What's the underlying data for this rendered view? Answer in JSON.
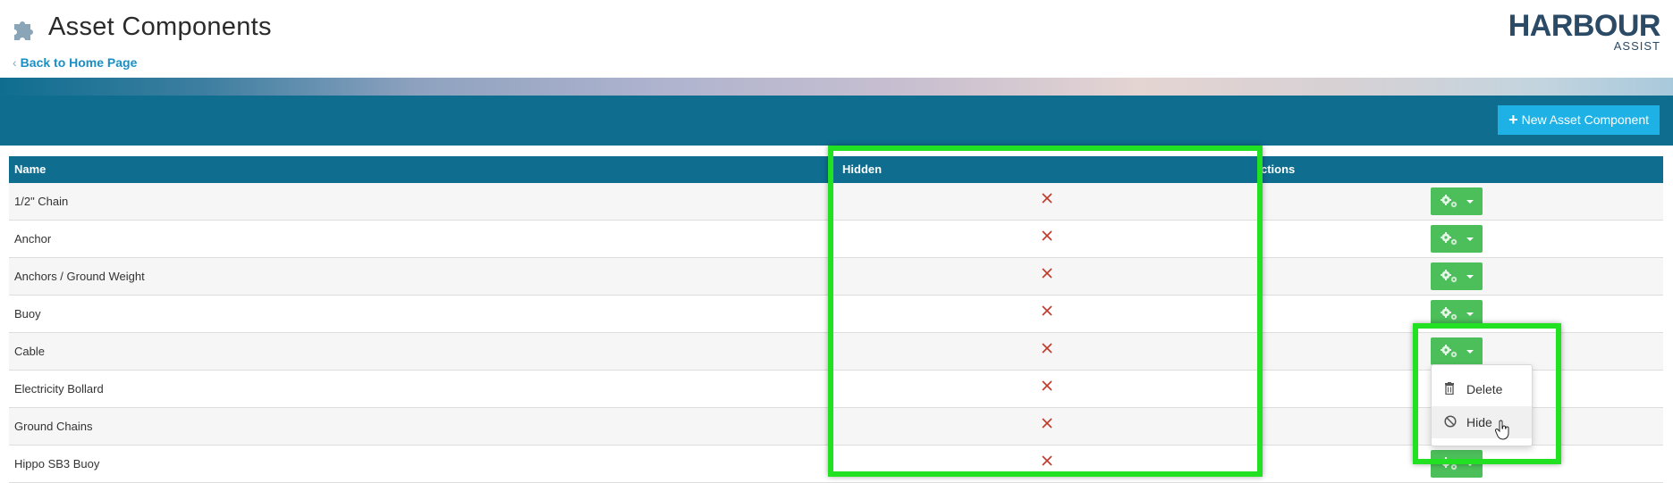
{
  "header": {
    "title": "Asset Components",
    "back_link": "Back to Home Page",
    "logo_main": "HARBOUR",
    "logo_sub": "ASSIST"
  },
  "toolbar": {
    "new_button_label": "New Asset Component"
  },
  "table": {
    "columns": [
      "Name",
      "Hidden",
      "ctions"
    ],
    "rows": [
      {
        "name": "1/2\" Chain",
        "hidden": "×"
      },
      {
        "name": "Anchor",
        "hidden": "×"
      },
      {
        "name": "Anchors / Ground Weight",
        "hidden": "×"
      },
      {
        "name": "Buoy",
        "hidden": "×"
      },
      {
        "name": "Cable",
        "hidden": "×"
      },
      {
        "name": "Electricity Bollard",
        "hidden": "×"
      },
      {
        "name": "Ground Chains",
        "hidden": "×"
      },
      {
        "name": "Hippo SB3 Buoy",
        "hidden": "×"
      }
    ]
  },
  "dropdown": {
    "items": [
      "Delete",
      "Hide"
    ]
  },
  "icons": {
    "header": "puzzle-icon",
    "back": "chevron-left-icon",
    "new": "plus-icon",
    "hidden_value": "x-mark-icon",
    "action": "gears-icon",
    "delete": "trash-icon",
    "hide": "ban-icon"
  },
  "colors": {
    "brand_blue": "#0f6e90",
    "new_button": "#1db1e6",
    "action_button": "#4cbf5a",
    "x_mark": "#c0392b",
    "highlight": "#22e022",
    "link": "#1a8fc6"
  }
}
